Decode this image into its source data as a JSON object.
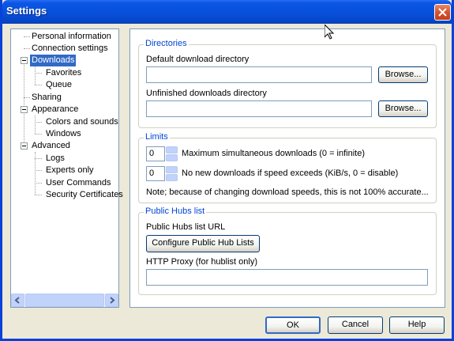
{
  "window": {
    "title": "Settings"
  },
  "tree": {
    "items": [
      {
        "label": "Personal information"
      },
      {
        "label": "Connection settings"
      },
      {
        "label": "Downloads"
      },
      {
        "label": "Favorites"
      },
      {
        "label": "Queue"
      },
      {
        "label": "Sharing"
      },
      {
        "label": "Appearance"
      },
      {
        "label": "Colors and sounds"
      },
      {
        "label": "Windows"
      },
      {
        "label": "Advanced"
      },
      {
        "label": "Logs"
      },
      {
        "label": "Experts only"
      },
      {
        "label": "User Commands"
      },
      {
        "label": "Security Certificates"
      }
    ],
    "selected": "Downloads"
  },
  "directories": {
    "group_label": "Directories",
    "default_label": "Default download directory",
    "default_value": "",
    "unfinished_label": "Unfinished downloads directory",
    "unfinished_value": "",
    "browse_label": "Browse..."
  },
  "limits": {
    "group_label": "Limits",
    "max_downloads_value": "0",
    "max_downloads_label": "Maximum simultaneous downloads (0 = infinite)",
    "speed_value": "0",
    "speed_label": "No new downloads if speed exceeds (KiB/s, 0 = disable)",
    "note": "Note; because of changing download speeds, this is not 100% accurate..."
  },
  "public_hubs": {
    "group_label": "Public Hubs list",
    "url_label": "Public Hubs list URL",
    "configure_button": "Configure Public Hub Lists",
    "proxy_label": "HTTP Proxy (for hublist only)",
    "proxy_value": ""
  },
  "footer": {
    "ok": "OK",
    "cancel": "Cancel",
    "help": "Help"
  }
}
